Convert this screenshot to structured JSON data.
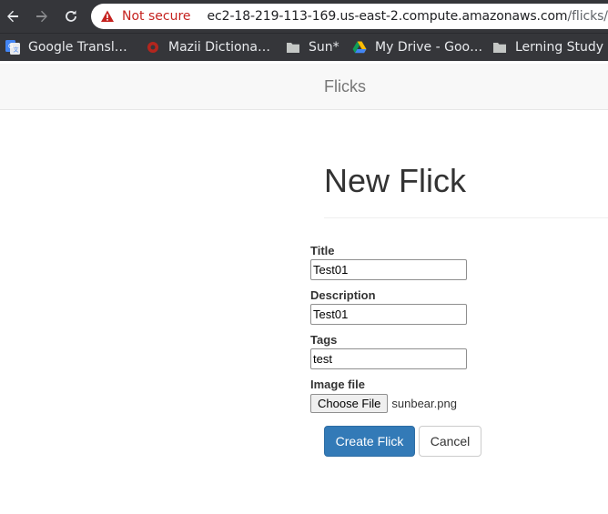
{
  "browser": {
    "security_label": "Not secure",
    "url_host": "ec2-18-219-113-169.us-east-2.compute.amazonaws.com",
    "url_path": "/flicks/new",
    "icons": [
      "back-arrow-icon",
      "forward-arrow-icon",
      "reload-icon",
      "warning-triangle-icon"
    ],
    "warning_color": "#c5221f"
  },
  "bookmarks": [
    {
      "label": "Google Transl…",
      "icon": "google-translate-icon"
    },
    {
      "label": "Mazii Dictiona…",
      "icon": "mazii-icon"
    },
    {
      "label": "Sun*",
      "icon": "folder-icon"
    },
    {
      "label": "My Drive - Goo…",
      "icon": "google-drive-icon"
    },
    {
      "label": "Lerning Study",
      "icon": "folder-icon"
    }
  ],
  "navbar": {
    "brand": "Flicks"
  },
  "page": {
    "heading": "New Flick"
  },
  "form": {
    "title_label": "Title",
    "title_value": "Test01",
    "description_label": "Description",
    "description_value": "Test01",
    "tags_label": "Tags",
    "tags_value": "test",
    "image_label": "Image file",
    "choose_file_label": "Choose File",
    "file_name": "sunbear.png",
    "submit_label": "Create Flick",
    "cancel_label": "Cancel"
  },
  "colors": {
    "primary": "#337ab7",
    "browser_chrome": "#35363a",
    "navbar_bg": "#f8f8f8"
  }
}
